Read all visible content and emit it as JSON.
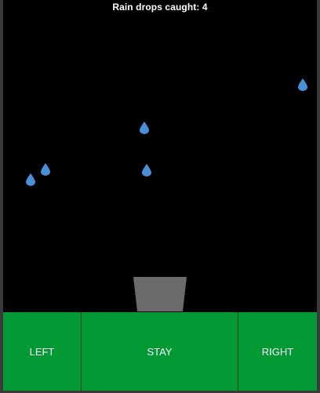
{
  "game": {
    "score_label": "Rain drops caught: 4"
  },
  "colors": {
    "sky": "#000000",
    "drop": "#4a90d9",
    "bucket": "#6b6b6b",
    "button": "#009933",
    "button_text": "#ffffff"
  },
  "drops": [
    {
      "icon": "raindrop-icon"
    },
    {
      "icon": "raindrop-icon"
    },
    {
      "icon": "raindrop-icon"
    },
    {
      "icon": "raindrop-icon"
    },
    {
      "icon": "raindrop-icon"
    },
    {
      "icon": "raindrop-icon"
    }
  ],
  "bucket": {
    "icon": "bucket-icon"
  },
  "controls": {
    "left_label": "LEFT",
    "stay_label": "STAY",
    "right_label": "RIGHT"
  }
}
